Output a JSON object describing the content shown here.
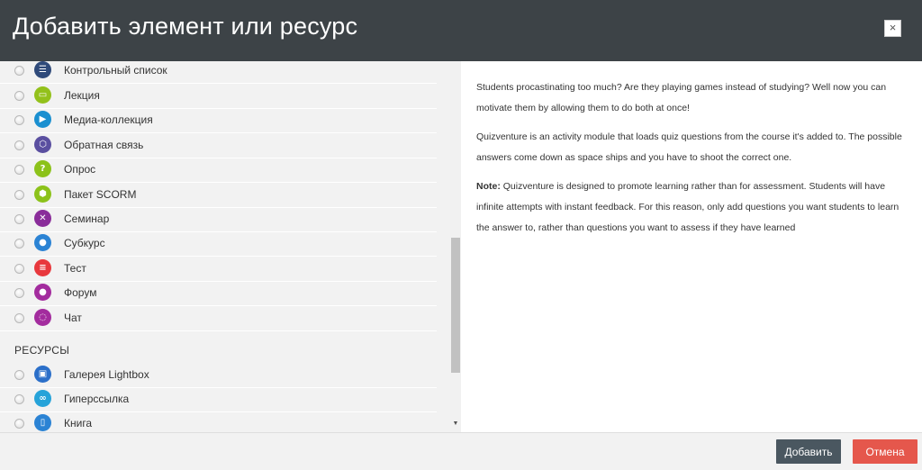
{
  "header": {
    "title": "Добавить элемент или ресурс",
    "close_label": "×"
  },
  "activities": [
    {
      "label": "Контрольный список",
      "icon": "checklist-icon",
      "color": "#2f4a7a",
      "glyph": "☰"
    },
    {
      "label": "Лекция",
      "icon": "lesson-icon",
      "color": "#93c11b",
      "glyph": "▭"
    },
    {
      "label": "Медиа-коллекция",
      "icon": "media-collection-icon",
      "color": "#1a8fd0",
      "glyph": "▶"
    },
    {
      "label": "Обратная связь",
      "icon": "feedback-icon",
      "color": "#5a4fa0",
      "glyph": "⬡"
    },
    {
      "label": "Опрос",
      "icon": "choice-icon",
      "color": "#8cc21a",
      "glyph": "?"
    },
    {
      "label": "Пакет SCORM",
      "icon": "scorm-icon",
      "color": "#8cc21a",
      "glyph": "⬢"
    },
    {
      "label": "Семинар",
      "icon": "workshop-icon",
      "color": "#8a2d9a",
      "glyph": "✕"
    },
    {
      "label": "Субкурс",
      "icon": "subcourse-icon",
      "color": "#2b83d4",
      "glyph": "●"
    },
    {
      "label": "Тест",
      "icon": "quiz-icon",
      "color": "#e8383d",
      "glyph": "≡"
    },
    {
      "label": "Форум",
      "icon": "forum-icon",
      "color": "#a32c9e",
      "glyph": "●"
    },
    {
      "label": "Чат",
      "icon": "chat-icon",
      "color": "#a32c9e",
      "glyph": "◌"
    }
  ],
  "resources_section": {
    "title": "РЕСУРСЫ"
  },
  "resources": [
    {
      "label": "Галерея Lightbox",
      "icon": "lightbox-gallery-icon",
      "color": "#2b6fc9",
      "glyph": "▣"
    },
    {
      "label": "Гиперссылка",
      "icon": "url-link-icon",
      "color": "#26a3d9",
      "glyph": "∞"
    },
    {
      "label": "Книга",
      "icon": "book-icon",
      "color": "#2b83d4",
      "glyph": "▯"
    }
  ],
  "description": {
    "p1": "Students procastinating too much? Are they playing games instead of studying? Well now you can motivate them by allowing them to do both at once!",
    "p2": "Quizventure is an activity module that loads quiz questions from the course it's added to. The possible answers come down as space ships and you have to shoot the correct one.",
    "note_label": "Note:",
    "note_text": " Quizventure is designed to promote learning rather than for assessment. Students will have infinite attempts with instant feedback. For this reason, only add questions you want students to learn the answer to, rather than questions you want to assess if they have learned"
  },
  "footer": {
    "add_label": "Добавить",
    "cancel_label": "Отмена"
  },
  "colors": {
    "header_bg": "#3d4347",
    "add_button": "#4a5760",
    "cancel_button": "#e5574c",
    "list_bg": "#f2f2f2"
  }
}
